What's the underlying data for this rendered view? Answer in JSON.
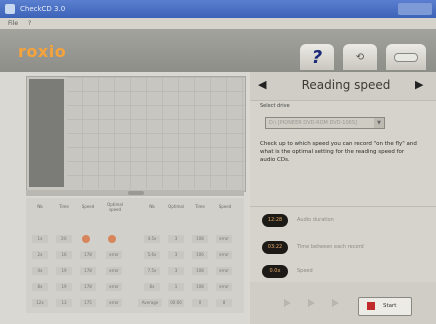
{
  "window": {
    "title": "CheckCD 3.0"
  },
  "menubar": {
    "items": [
      "File",
      "?"
    ]
  },
  "header": {
    "logo": "roxio",
    "help_label": "?"
  },
  "left_table": {
    "headers": [
      "Nb",
      "Time",
      "Speed",
      "Optimal speed",
      "Nb",
      "Optimal",
      "Time",
      "Speed"
    ],
    "rows": [
      [
        "1x",
        "19:",
        "",
        "",
        "4.5x",
        "3",
        "108",
        "error"
      ],
      [
        "2x",
        "16",
        "178",
        "error",
        "5.6x",
        "3",
        "106",
        "error"
      ],
      [
        "4x",
        "19",
        "178",
        "error",
        "7.5x",
        "3",
        "108",
        "error"
      ],
      [
        "8x",
        "19",
        "178",
        "error",
        "8x",
        "1",
        "108",
        "error"
      ],
      [
        "12x",
        "13",
        "175",
        "error",
        "Average",
        "00:00",
        "0",
        "8"
      ]
    ]
  },
  "right_panel": {
    "title": "Reading speed",
    "select_label": "Select drive",
    "select_value": "D:\\ [PIONEER DVD-ROM DVD-106S]",
    "description": "Check up to which speed you can record \"on the fly\" and what is the optimal setting for the reading speed for audio CDs.",
    "results": [
      {
        "value": "12:28",
        "label": "Audio duration"
      },
      {
        "value": "03:22",
        "label": "Time between each record"
      },
      {
        "value": "0.0x",
        "label": "Speed"
      }
    ],
    "start_label": "Start"
  }
}
